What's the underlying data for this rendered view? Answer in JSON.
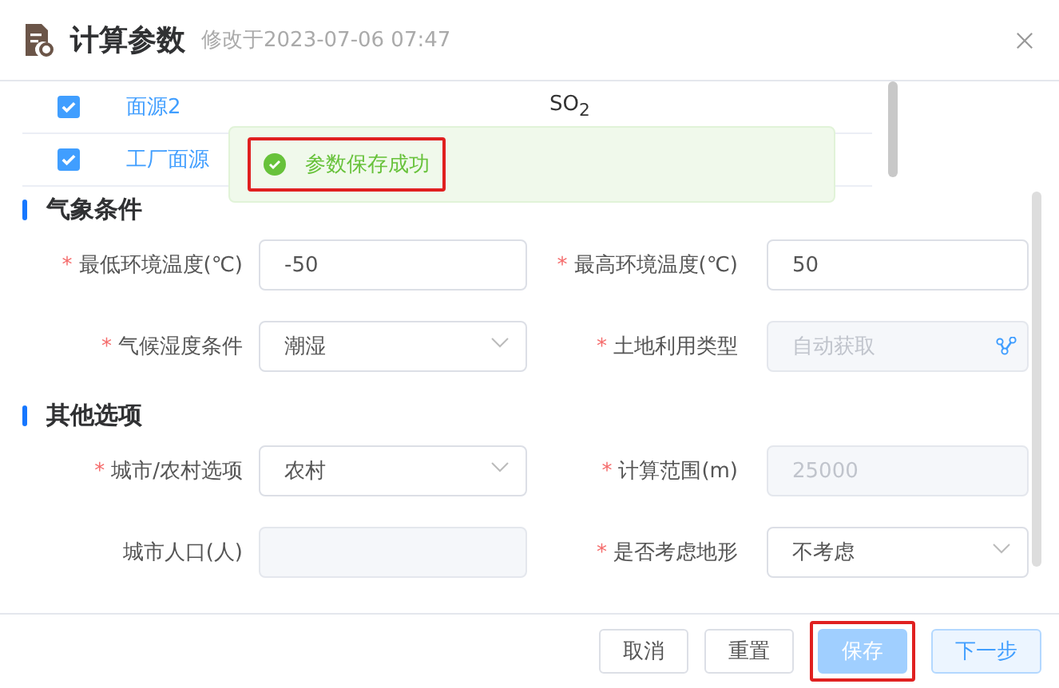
{
  "header": {
    "title": "计算参数",
    "subtitle": "修改于2023-07-06 07:47"
  },
  "table": {
    "rows": [
      {
        "checked": true,
        "name": "面源2",
        "pollutant": "SO$_{2}$"
      },
      {
        "checked": true,
        "name": "工厂面源"
      }
    ]
  },
  "toast": {
    "text": "参数保存成功",
    "highlighted": true
  },
  "sections": [
    {
      "title": "气象条件",
      "fields": [
        {
          "label": "最低环境温度(℃)",
          "required_mark": "*",
          "kind": "text",
          "value": "-50"
        },
        {
          "label": "最高环境温度(℃)",
          "required_mark": "*",
          "kind": "text",
          "value": "50"
        },
        {
          "label": "气候湿度条件",
          "required_mark": "*",
          "kind": "select",
          "value": "潮湿"
        },
        {
          "label": "土地利用类型",
          "required_mark": "*",
          "kind": "picker",
          "placeholder": "自动获取"
        }
      ]
    },
    {
      "title": "其他选项",
      "fields": [
        {
          "label": "城市/农村选项",
          "required_mark": "*",
          "kind": "select",
          "value": "农村"
        },
        {
          "label": "计算范围(m)",
          "required_mark": "*",
          "kind": "disabled",
          "value": "25000"
        },
        {
          "label": "城市人口(人)",
          "kind": "disabled"
        },
        {
          "label": "是否考虑地形",
          "required_mark": "*",
          "kind": "select",
          "value": "不考虑"
        }
      ]
    }
  ],
  "buttons": [
    {
      "label": "取消",
      "kind": "default",
      "disabled": false,
      "highlighted": false
    },
    {
      "label": "重置",
      "kind": "default",
      "disabled": false,
      "highlighted": false
    },
    {
      "label": "保存",
      "kind": "primary",
      "disabled": true,
      "highlighted": true
    },
    {
      "label": "下一步",
      "kind": "plain",
      "disabled": false,
      "highlighted": false
    }
  ]
}
